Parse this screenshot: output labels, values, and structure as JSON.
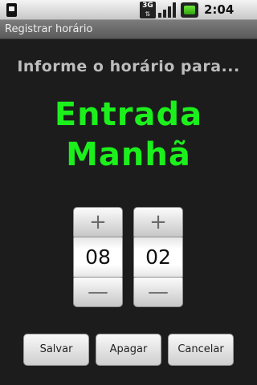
{
  "status_bar": {
    "network_label": "3G",
    "time": "2:04 AM",
    "icons": [
      "sim-card-icon",
      "3g-data-icon",
      "signal-strength-icon",
      "battery-icon"
    ]
  },
  "app": {
    "title": "Registrar horário"
  },
  "prompt": "Informe o horário para...",
  "heading": {
    "line1": "Entrada",
    "line2": "Manhã"
  },
  "time_picker": {
    "hour": "08",
    "minute": "02",
    "increment_symbol": "+",
    "decrement_symbol": "—"
  },
  "buttons": {
    "save": "Salvar",
    "clear": "Apagar",
    "cancel": "Cancelar"
  },
  "colors": {
    "heading": "#1cf01c",
    "prompt": "#bdbdbd",
    "background": "#1c1c1c"
  }
}
